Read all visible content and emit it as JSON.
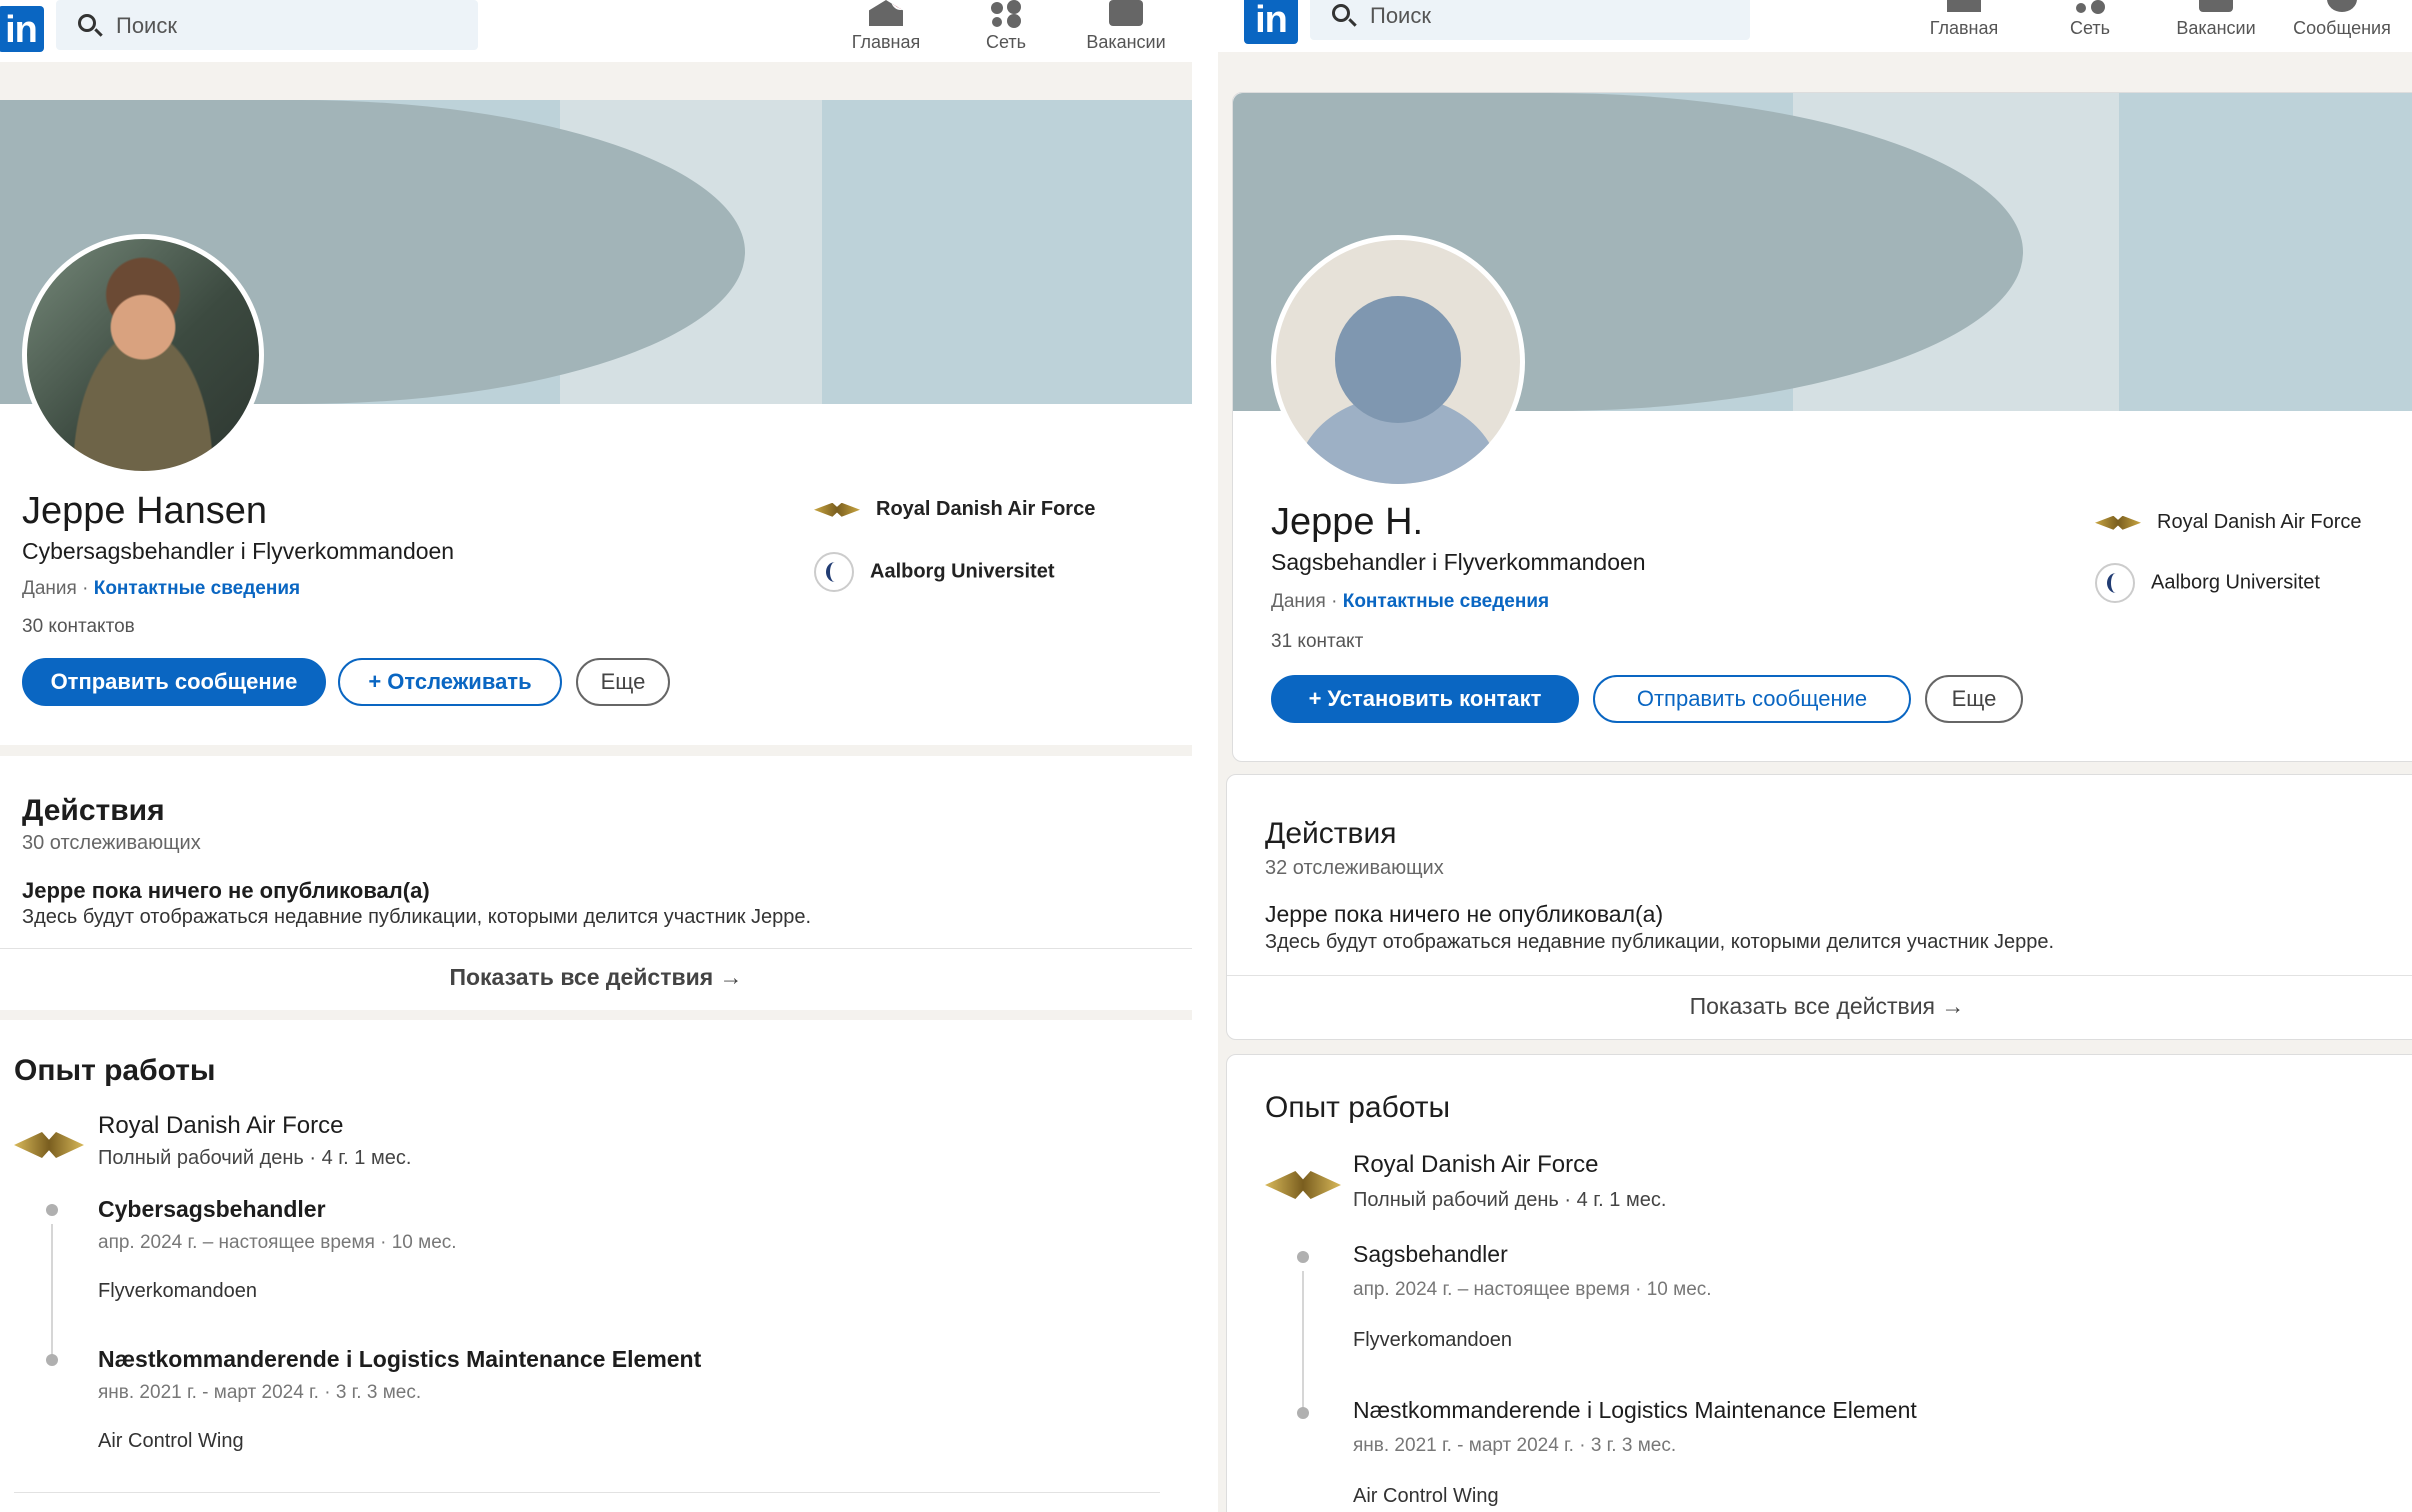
{
  "nav": {
    "search_placeholder": "Поиск",
    "home": "Главная",
    "network": "Сеть",
    "jobs": "Вакансии",
    "messages": "Сообщения"
  },
  "left": {
    "name": "Jeppe Hansen",
    "headline": "Cybersagsbehandler i Flyverkommandoen",
    "location": "Дания",
    "contact_info": "Контактные сведения",
    "connections": "30 контактов",
    "btn_message": "Отправить сообщение",
    "btn_follow": "Отслеживать",
    "btn_more": "Еще",
    "orgs": [
      "Royal Danish Air Force",
      "Aalborg Universitet"
    ],
    "activity": {
      "title": "Действия",
      "followers": "30 отслеживающих",
      "empty_title": "Jeppe пока ничего не опубликовал(а)",
      "empty_desc": "Здесь будут отображаться недавние публикации, которыми делится участник Jeppe.",
      "show_all": "Показать все действия →"
    },
    "experience": {
      "title": "Опыт работы",
      "company": "Royal Danish Air Force",
      "company_meta": "Полный рабочий день · 4 г. 1 мес.",
      "roles": [
        {
          "title": "Cybersagsbehandler",
          "dates": "апр. 2024 г. – настоящее время · 10 мес.",
          "unit": "Flyverkomandoen"
        },
        {
          "title": "Næstkommanderende i Logistics Maintenance Element",
          "dates": "янв. 2021 г. - март 2024 г. · 3 г. 3 мес.",
          "unit": "Air Control Wing"
        }
      ]
    }
  },
  "right": {
    "name": "Jeppe H.",
    "headline": "Sagsbehandler i Flyverkommandoen",
    "location": "Дания",
    "contact_info": "Контактные сведения",
    "connections": "31 контакт",
    "btn_connect": "Установить контакт",
    "btn_message": "Отправить сообщение",
    "btn_more": "Еще",
    "orgs": [
      "Royal Danish Air Force",
      "Aalborg Universitet"
    ],
    "activity": {
      "title": "Действия",
      "followers": "32 отслеживающих",
      "empty_title": "Jeppe пока ничего не опубликовал(а)",
      "empty_desc": "Здесь будут отображаться недавние публикации, которыми делится участник Jeppe.",
      "show_all": "Показать все действия →"
    },
    "experience": {
      "title": "Опыт работы",
      "company": "Royal Danish Air Force",
      "company_meta": "Полный рабочий день · 4 г. 1 мес.",
      "roles": [
        {
          "title": "Sagsbehandler",
          "dates": "апр. 2024 г. – настоящее время · 10 мес.",
          "unit": "Flyverkomandoen"
        },
        {
          "title": "Næstkommanderende i Logistics Maintenance Element",
          "dates": "янв. 2021 г. - март 2024 г. · 3 г. 3 мес.",
          "unit": "Air Control Wing"
        }
      ]
    }
  }
}
